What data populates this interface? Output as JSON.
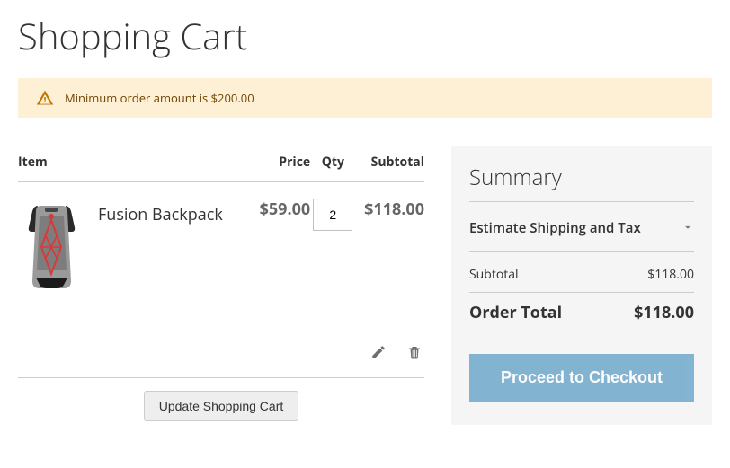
{
  "page": {
    "title": "Shopping Cart"
  },
  "message": {
    "text": "Minimum order amount is $200.00"
  },
  "cart": {
    "columns": {
      "item": "Item",
      "price": "Price",
      "qty": "Qty",
      "subtotal": "Subtotal"
    },
    "items": [
      {
        "name": "Fusion Backpack",
        "price": "$59.00",
        "qty": "2",
        "subtotal": "$118.00"
      }
    ],
    "update_label": "Update Shopping Cart"
  },
  "summary": {
    "title": "Summary",
    "estimate_label": "Estimate Shipping and Tax",
    "subtotal_label": "Subtotal",
    "subtotal_value": "$118.00",
    "order_total_label": "Order Total",
    "order_total_value": "$118.00",
    "checkout_label": "Proceed to Checkout"
  }
}
